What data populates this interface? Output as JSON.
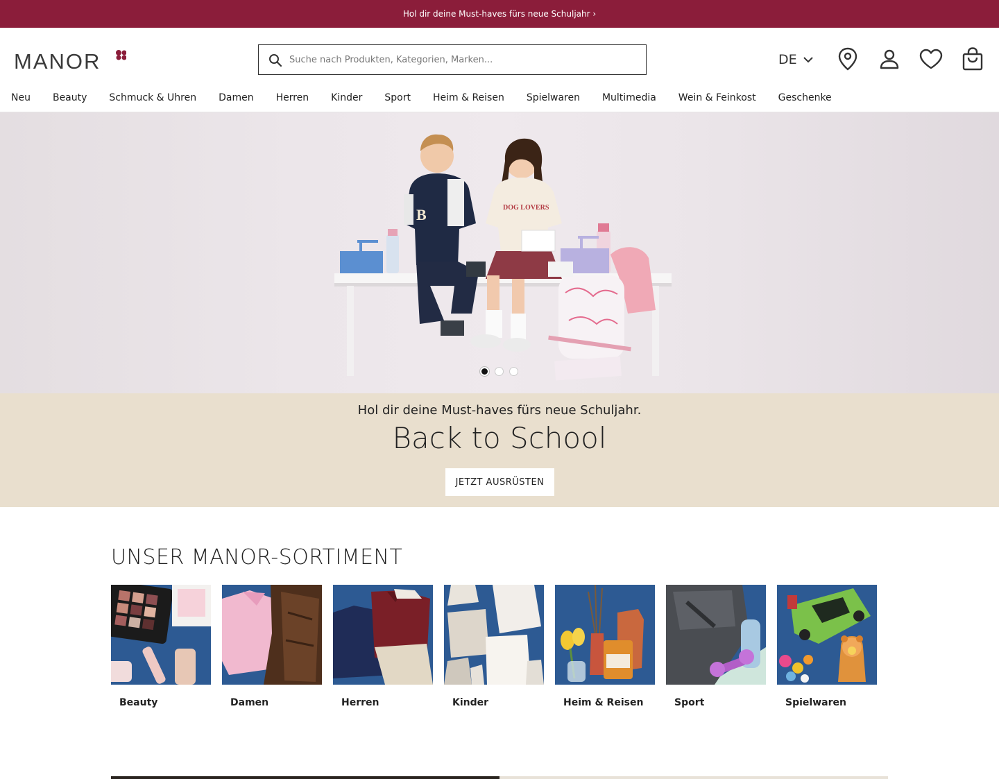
{
  "promo": {
    "text": "Hol dir deine Must-haves fürs neue Schuljahr ›"
  },
  "header": {
    "logo_text": "MANOR",
    "search": {
      "placeholder": "Suche nach Produkten, Kategorien, Marken...",
      "value": ""
    },
    "language": "DE",
    "icons": [
      "location-icon",
      "account-icon",
      "heart-icon",
      "bag-icon"
    ]
  },
  "nav": {
    "items": [
      "Neu",
      "Beauty",
      "Schmuck & Uhren",
      "Damen",
      "Herren",
      "Kinder",
      "Sport",
      "Heim & Reisen",
      "Spielwaren",
      "Multimedia",
      "Wein & Feinkost",
      "Geschenke"
    ]
  },
  "hero": {
    "slides_total": 3,
    "active_slide": 1,
    "sweater_text": "DOG LOVERS"
  },
  "banner": {
    "subtitle": "Hol dir deine Must-haves fürs neue Schuljahr.",
    "title": "Back to School",
    "cta": "JETZT AUSRÜSTEN"
  },
  "assortment": {
    "title": "UNSER MANOR-SORTIMENT",
    "categories": [
      "Beauty",
      "Damen",
      "Herren",
      "Kinder",
      "Heim & Reisen",
      "Sport",
      "Spielwaren"
    ]
  },
  "colors": {
    "brand": "#8b1d3a",
    "banner_bg": "#e9dfce",
    "tile_bg": "#2f5d95"
  }
}
